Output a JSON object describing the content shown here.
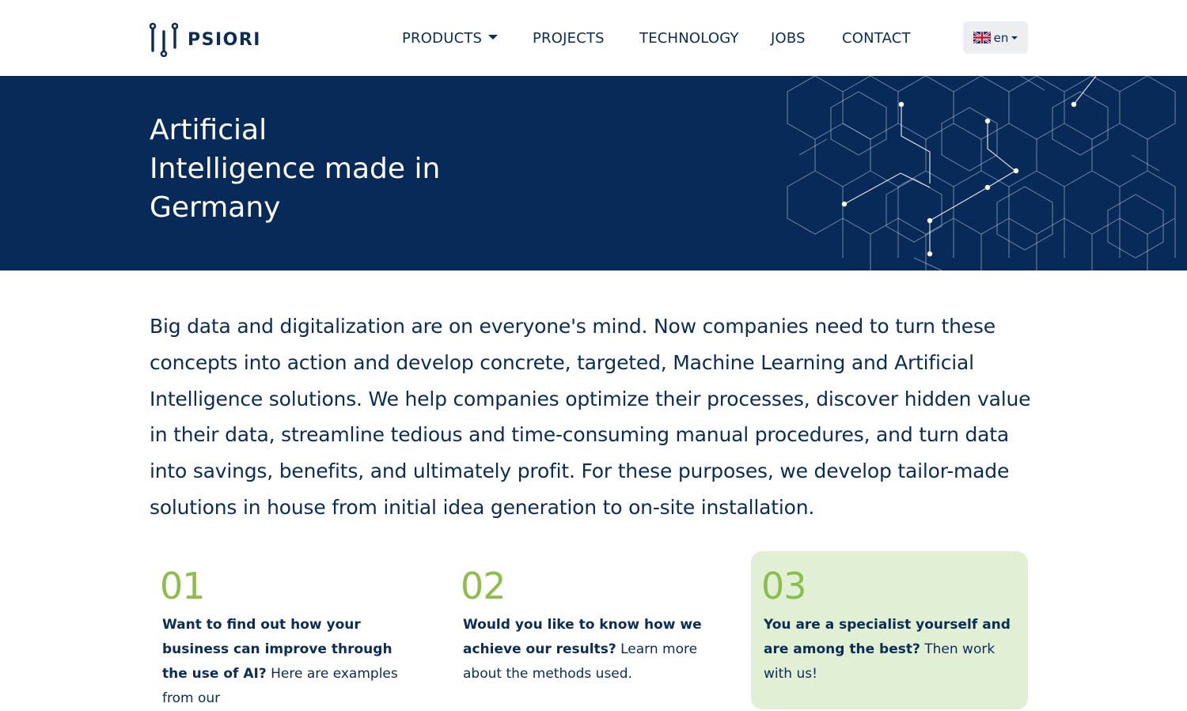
{
  "brand": {
    "name": "PSIORI"
  },
  "nav": {
    "items": [
      {
        "label": "PRODUCTS",
        "has_dropdown": true
      },
      {
        "label": "PROJECTS"
      },
      {
        "label": "TECHNOLOGY"
      },
      {
        "label": "JOBS"
      },
      {
        "label": "CONTACT"
      }
    ],
    "language": {
      "label": "en",
      "flag": "uk-flag-icon"
    }
  },
  "hero": {
    "title_lines": [
      "Artificial",
      "Intelligence made in",
      "Germany"
    ],
    "decoration": "hexagon-network-graphic"
  },
  "intro": {
    "text": "Big data and digitalization are on everyone's mind. Now companies need to turn these concepts into action and develop concrete, targeted, Machine Learning and Artificial Intelligence solutions. We help companies optimize their processes, discover hidden value in their data, streamline tedious and time-consuming manual procedures, and turn data into savings, benefits, and ultimately profit. For these purposes, we develop tailor-made solutions in house from initial idea generation to on-site installation."
  },
  "cards": [
    {
      "number": "01",
      "bold": "Want to find out how your business can improve through the use of AI?",
      "text": "Here are examples from our",
      "highlighted": false
    },
    {
      "number": "02",
      "bold": "Would you like to know how we achieve our results?",
      "text": "Learn more about the methods used.",
      "highlighted": false
    },
    {
      "number": "03",
      "bold": "You are a specialist yourself and are among the best?",
      "text": "Then work with us!",
      "highlighted": true
    }
  ],
  "colors": {
    "navy": "#0b2c56",
    "hero_bg": "#082a58",
    "accent_green": "#8dbe4c",
    "card_highlight": "#e1efd5",
    "lang_button_bg": "#eceeef"
  }
}
